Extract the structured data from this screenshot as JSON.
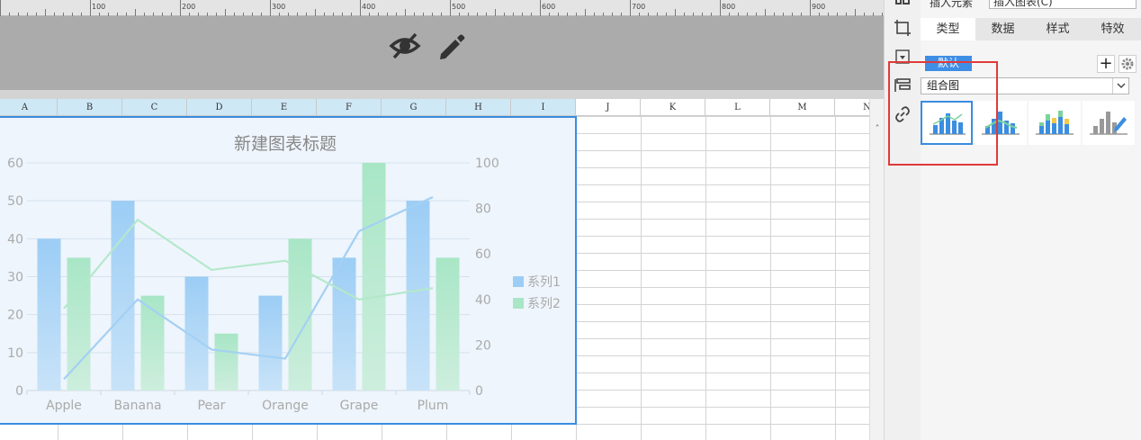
{
  "ruler": {
    "labels": [
      "100",
      "200",
      "300",
      "400",
      "500",
      "600",
      "700",
      "800",
      "900"
    ]
  },
  "toolbar": {
    "hide_icon": "eye-slash-icon",
    "edit_icon": "pencil-icon"
  },
  "sheet": {
    "columns": [
      "A",
      "B",
      "C",
      "D",
      "E",
      "F",
      "G",
      "H",
      "I",
      "J",
      "K",
      "L",
      "M",
      "N"
    ]
  },
  "right_panel": {
    "insert_element_label": "插入元素",
    "insert_chart_value": "插入图表(C)",
    "tabs": [
      {
        "label": "类型"
      },
      {
        "label": "数据"
      },
      {
        "label": "样式"
      },
      {
        "label": "特效"
      }
    ],
    "active_tab": "类型",
    "default_button": "默认",
    "chart_type_value": "组合图",
    "thumbnails": [
      "combo-bar-line-thumbnail",
      "stacked-combo-thumbnail",
      "multi-series-combo-thumbnail",
      "custom-combo-thumbnail"
    ]
  },
  "colors": {
    "series1": "#9ccdf5",
    "series2": "#a8e6c6",
    "selection": "#3a8ce0",
    "highlight_box": "#e03a3a",
    "active_button": "#3f8ee6"
  },
  "chart_data": {
    "type": "bar",
    "title": "新建图表标题",
    "categories": [
      "Apple",
      "Banana",
      "Pear",
      "Orange",
      "Grape",
      "Plum"
    ],
    "series": [
      {
        "name": "系列1",
        "values": [
          40,
          50,
          30,
          25,
          35,
          50
        ],
        "line_values": [
          5,
          40,
          18,
          14,
          70,
          85
        ]
      },
      {
        "name": "系列2",
        "values": [
          35,
          25,
          15,
          40,
          60,
          35
        ],
        "line_values": [
          36,
          75,
          53,
          57,
          40,
          45
        ]
      }
    ],
    "ylim_left": [
      0,
      60
    ],
    "ylim_right": [
      0,
      100
    ],
    "yticks_left": [
      "0",
      "10",
      "20",
      "30",
      "40",
      "50",
      "60"
    ],
    "yticks_right": [
      "0",
      "20",
      "40",
      "60",
      "80",
      "100"
    ],
    "grid": true,
    "legend": "right"
  }
}
